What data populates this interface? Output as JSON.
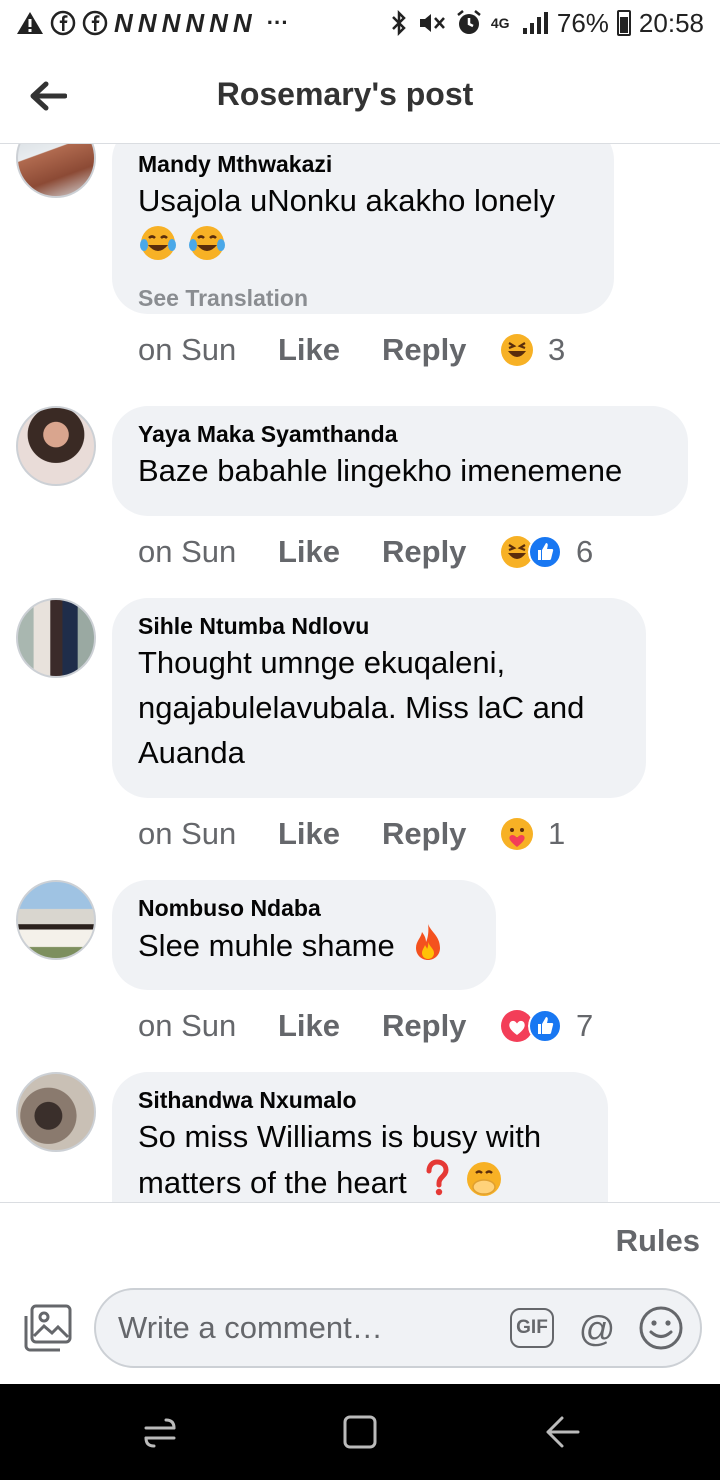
{
  "status_bar": {
    "left_icons": [
      "warning-icon",
      "facebook-icon",
      "facebook-icon",
      "n-icon",
      "n-icon",
      "n-icon",
      "n-icon",
      "n-icon",
      "n-icon",
      "more-icon"
    ],
    "n_glyph": "N",
    "more_glyph": "···",
    "network": "4G",
    "battery": "76%",
    "time": "20:58"
  },
  "header": {
    "title": "Rosemary's post",
    "back_icon": "arrow-left-icon"
  },
  "comments": [
    {
      "author": "Mandy Mthwakazi",
      "text": "Usajola uNonku akakho lonely",
      "inline_emojis": [
        "tears-of-joy",
        "tears-of-joy"
      ],
      "see_translation": "See Translation",
      "time": "on Sun",
      "like": "Like",
      "reply": "Reply",
      "reactions": [
        "haha"
      ],
      "reaction_count": "3"
    },
    {
      "author": "Yaya Maka Syamthanda",
      "text": "Baze babahle lingekho imenemene",
      "time": "on Sun",
      "like": "Like",
      "reply": "Reply",
      "reactions": [
        "haha",
        "like"
      ],
      "reaction_count": "6"
    },
    {
      "author": "Sihle Ntumba Ndlovu",
      "text_lines": [
        "Thought umnge ekuqaleni,",
        "ngajabulelavubala. Miss laC and",
        "Auanda"
      ],
      "time": "on Sun",
      "like": "Like",
      "reply": "Reply",
      "reactions": [
        "care"
      ],
      "reaction_count": "1"
    },
    {
      "author": "Nombuso Ndaba",
      "text": "Slee muhle shame",
      "inline_emojis": [
        "fire"
      ],
      "time": "on Sun",
      "like": "Like",
      "reply": "Reply",
      "reactions": [
        "love",
        "like"
      ],
      "reaction_count": "7"
    },
    {
      "author": "Sithandwa Nxumalo",
      "text_lines": [
        "So miss Williams is busy with",
        "matters of the heart"
      ],
      "inline_emojis": [
        "question-mark",
        "hand-over-mouth"
      ]
    }
  ],
  "footer": {
    "rules": "Rules",
    "placeholder": "Write a comment…",
    "gif": "GIF",
    "at": "@"
  },
  "colors": {
    "bubble": "#f0f2f5",
    "like_blue": "#1877f2",
    "love_red": "#f33e58",
    "haha_yellow": "#f7b125",
    "muted": "#65676b"
  }
}
